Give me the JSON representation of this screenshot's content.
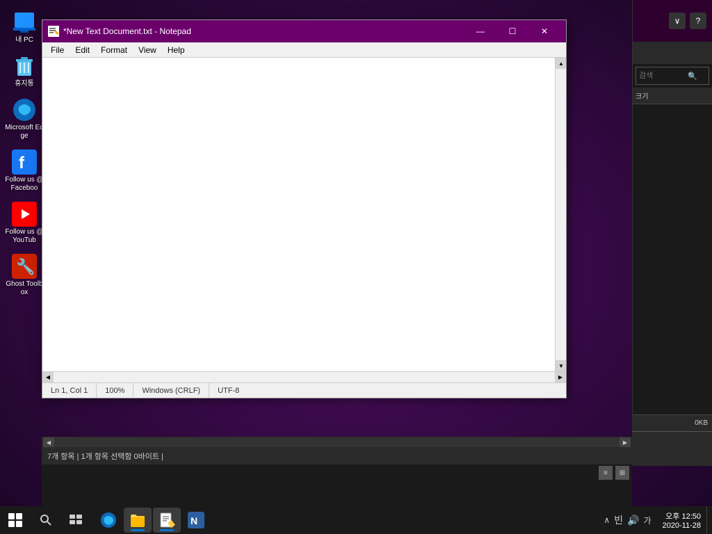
{
  "desktop": {
    "icons": [
      {
        "id": "my-pc",
        "label": "내 PC",
        "type": "pc"
      },
      {
        "id": "recycle",
        "label": "휴지통",
        "type": "recycle"
      },
      {
        "id": "edge",
        "label": "Microsoft Edge",
        "type": "edge"
      },
      {
        "id": "facebook",
        "label": "Follow us @Faceboo",
        "type": "facebook"
      },
      {
        "id": "youtube",
        "label": "Follow us @YouTub",
        "type": "youtube"
      },
      {
        "id": "ghost",
        "label": "Ghost Toolbox",
        "type": "ghost"
      }
    ]
  },
  "notepad": {
    "title": "*New Text Document.txt - Notepad",
    "menu": [
      "File",
      "Edit",
      "Format",
      "View",
      "Help"
    ],
    "content": "",
    "status": {
      "position": "Ln 1, Col 1",
      "zoom": "100%",
      "lineending": "Windows (CRLF)",
      "encoding": "UTF-8"
    }
  },
  "right_panel": {
    "search_placeholder": "검색",
    "col_header": "크기",
    "file_size": "0KB"
  },
  "bottom_panel": {
    "status": "7개 항목  |  1개 항목 선택함 0바이트  |"
  },
  "taskbar": {
    "clock": {
      "time": "오후 12:50",
      "date": "2020-11-28"
    },
    "systray": [
      "∧",
      "빈",
      "🔊",
      "가"
    ]
  }
}
